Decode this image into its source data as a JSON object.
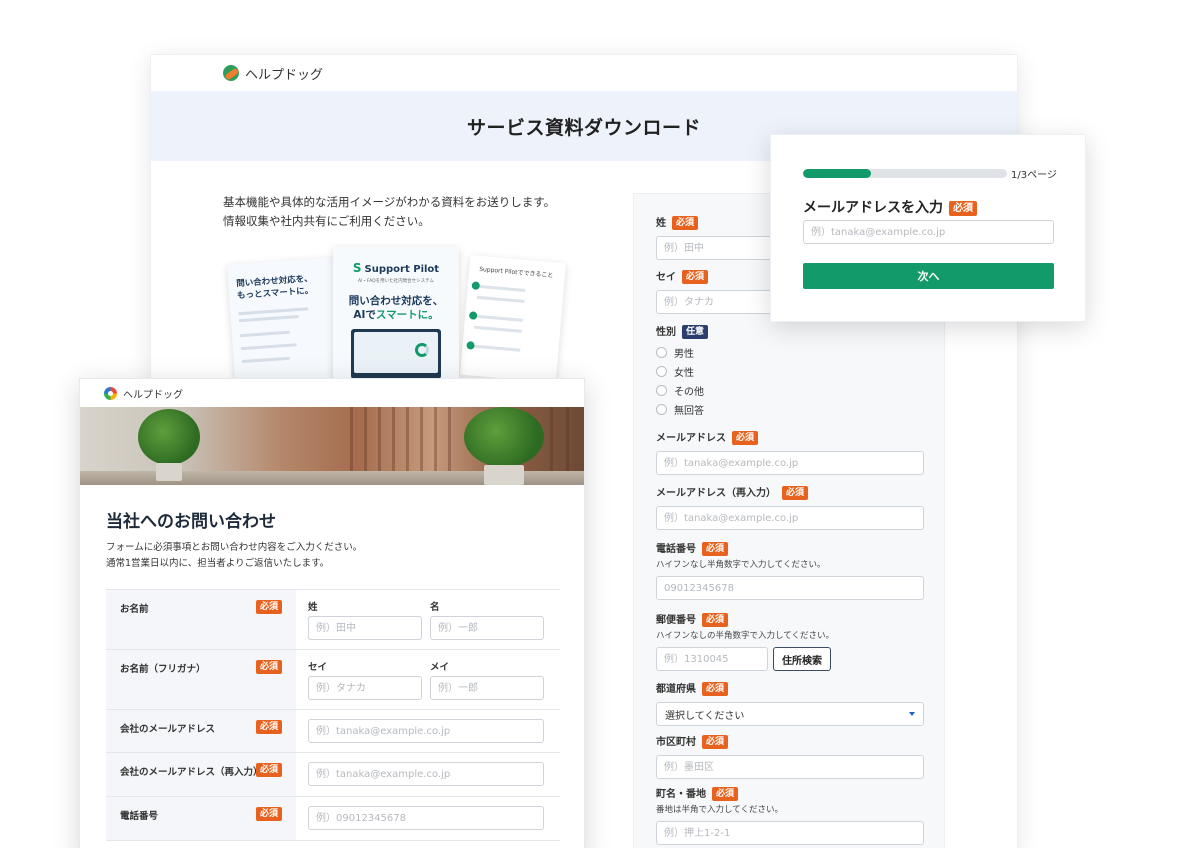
{
  "colors": {
    "accent": "#139a6b",
    "required_badge": "#e8621f",
    "optional_badge": "#2c3e6e",
    "hero_band": "#eef3fb"
  },
  "back_window": {
    "brand": "ヘルプドッグ",
    "title": "サービス資料ダウンロード",
    "intro_line1": "基本機能や具体的な活用イメージがわかる資料をお送りします。",
    "intro_line2": "情報収集や社内共有にご利用ください。",
    "brochure": {
      "left_title_1": "問い合わせ対応を、",
      "left_title_2": "もっとスマートに。",
      "center_logo": "Support Pilot",
      "center_sub": "AI・FAQを用いた社内問合せシステム",
      "center_headline_1": "問い合わせ対応を、",
      "center_headline_2a": "AIで",
      "center_headline_2b": "スマートに。",
      "right_title": "Support Pilotでできること"
    },
    "form": {
      "required_label": "必須",
      "optional_label": "任意",
      "last_name": {
        "label": "姓",
        "placeholder": "例）田中"
      },
      "last_name_kana": {
        "label": "セイ",
        "placeholder": "例）タナカ"
      },
      "gender": {
        "label": "性別",
        "options": [
          "男性",
          "女性",
          "その他",
          "無回答"
        ]
      },
      "email": {
        "label": "メールアドレス",
        "placeholder": "例）tanaka@example.co.jp"
      },
      "email_confirm": {
        "label": "メールアドレス（再入力）",
        "placeholder": "例）tanaka@example.co.jp"
      },
      "phone": {
        "label": "電話番号",
        "help": "ハイフンなし半角数字で入力してください。",
        "placeholder": "09012345678"
      },
      "zip": {
        "label": "郵便番号",
        "help": "ハイフンなしの半角数字で入力してください。",
        "placeholder": "例）1310045",
        "button": "住所検索"
      },
      "prefecture": {
        "label": "都道府県",
        "value": "選択してください"
      },
      "city": {
        "label": "市区町村",
        "placeholder": "例）墨田区"
      },
      "street": {
        "label": "町名・番地",
        "help": "番地は半角で入力してください。",
        "placeholder": "例）押上1-2-1"
      }
    }
  },
  "popup": {
    "progress": 0.333,
    "page_indicator": "1/3ページ",
    "title": "メールアドレスを入力",
    "required_label": "必須",
    "email_placeholder": "例）tanaka@example.co.jp",
    "next_button": "次へ"
  },
  "front_window": {
    "brand": "ヘルプドッグ",
    "title": "当社へのお問い合わせ",
    "desc_line1": "フォームに必須事項とお問い合わせ内容をご入力ください。",
    "desc_line2": "通常1営業日以内に、担当者よりご返信いたします。",
    "required_label": "必須",
    "rows": {
      "name": {
        "label": "お名前",
        "sub1": "姓",
        "sub2": "名",
        "ph1": "例）田中",
        "ph2": "例）一郎"
      },
      "kana": {
        "label": "お名前（フリガナ）",
        "sub1": "セイ",
        "sub2": "メイ",
        "ph1": "例）タナカ",
        "ph2": "例）一郎"
      },
      "email": {
        "label": "会社のメールアドレス",
        "placeholder": "例）tanaka@example.co.jp"
      },
      "email_confirm": {
        "label": "会社のメールアドレス（再入力）",
        "placeholder": "例）tanaka@example.co.jp"
      },
      "phone": {
        "label": "電話番号",
        "placeholder": "例）09012345678"
      }
    }
  }
}
